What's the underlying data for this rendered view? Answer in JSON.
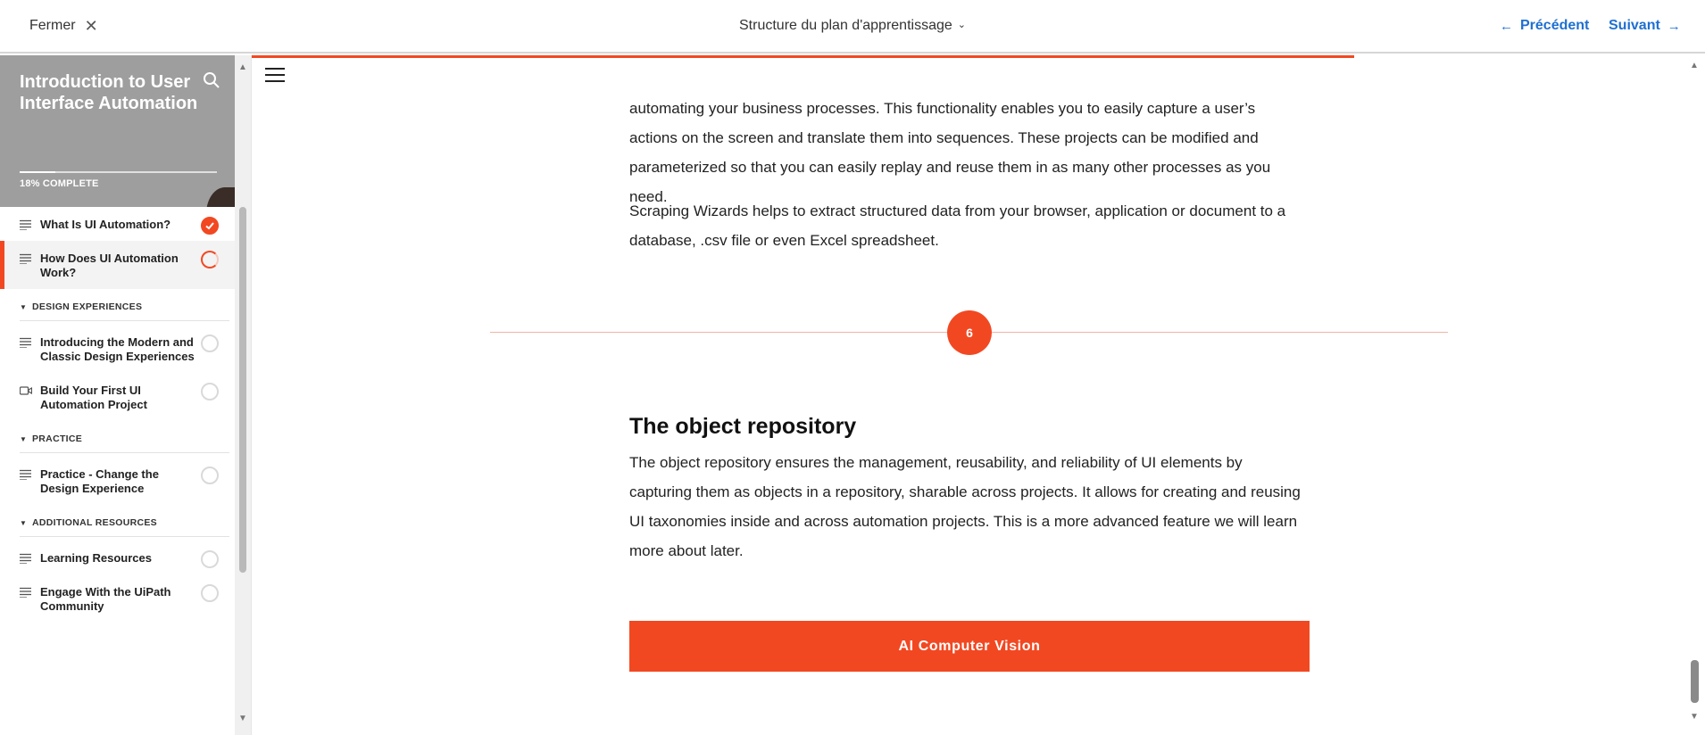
{
  "topbar": {
    "close_label": "Fermer",
    "title": "Structure du plan d'apprentissage",
    "prev_label": "Précédent",
    "next_label": "Suivant"
  },
  "sidebar": {
    "course_title": "Introduction to User Interface Automation",
    "progress_text": "18% COMPLETE",
    "progress_fraction": 0.18,
    "items": [
      {
        "type": "lesson",
        "label": "What Is UI Automation?",
        "icon": "text-lines-icon",
        "status": "done"
      },
      {
        "type": "lesson",
        "label": "How Does UI Automation Work?",
        "icon": "text-lines-icon",
        "status": "in-progress",
        "active": true
      },
      {
        "type": "section",
        "label": "DESIGN EXPERIENCES"
      },
      {
        "type": "lesson",
        "label": "Introducing the Modern and Classic Design Experiences",
        "icon": "text-lines-icon",
        "status": "not-started"
      },
      {
        "type": "lesson",
        "label": "Build Your First UI Automation Project",
        "icon": "video-icon",
        "status": "not-started"
      },
      {
        "type": "section",
        "label": "PRACTICE"
      },
      {
        "type": "lesson",
        "label": "Practice - Change the Design Experience",
        "icon": "text-lines-icon",
        "status": "not-started"
      },
      {
        "type": "section",
        "label": "ADDITIONAL RESOURCES"
      },
      {
        "type": "lesson",
        "label": "Learning Resources",
        "icon": "text-lines-icon",
        "status": "not-started"
      },
      {
        "type": "lesson",
        "label": "Engage With the UiPath Community",
        "icon": "text-lines-icon",
        "status": "not-started"
      }
    ]
  },
  "main": {
    "paragraph_1": "automating your business processes. This functionality enables you to easily capture a user’s actions on the screen and translate them into sequences. These projects can be modified and parameterized so that you can easily replay and reuse them in as many other processes as you need.",
    "paragraph_2": "Scraping Wizards helps to extract structured data from your browser, application or document to a database, .csv file or even Excel spreadsheet.",
    "step_number": "6",
    "section_heading": "The object repository",
    "paragraph_3": "The object repository ensures the management, reusability, and reliability of UI elements by capturing them as objects in a repository, sharable across projects. It allows for creating and reusing UI taxonomies inside and across automation projects. This is a more advanced feature we will learn more about later.",
    "cta_label": "AI Computer Vision"
  },
  "colors": {
    "accent": "#f24822",
    "link_blue": "#1f6fd1",
    "sidebar_header_bg": "#9e9e9e"
  }
}
